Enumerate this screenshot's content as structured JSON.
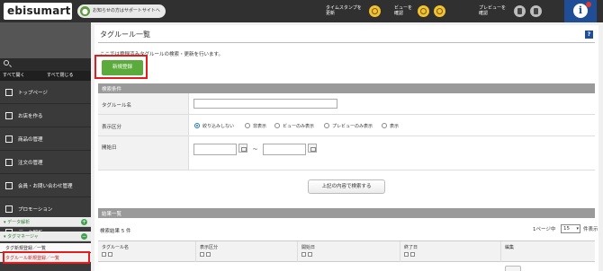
{
  "header": {
    "logo": "ebisumart",
    "support_label": "お知らせの方はサポートサイトへ",
    "timestamp_label": "タイムスタンプを\n更新",
    "view_label": "ビューを\n確認",
    "preview_label": "プレビューを\n確認",
    "info_label": "i"
  },
  "sidebar": {
    "expand_all": "すべて開く",
    "collapse_all": "すべて閉じる",
    "items": [
      {
        "label": "トップページ"
      },
      {
        "label": "お店を作る"
      },
      {
        "label": "商品の管理"
      },
      {
        "label": "注文の管理"
      },
      {
        "label": "会員・お問い合わせ管理"
      },
      {
        "label": "プロモーション"
      },
      {
        "label": "データ解析"
      }
    ],
    "groups": [
      {
        "label": "▾ データ解析",
        "toggle": "+"
      },
      {
        "label": "▾ タグマネージャ",
        "toggle": "−"
      }
    ],
    "subitems": [
      {
        "label": "タグ新規登録／一覧"
      },
      {
        "label": "タグルール新規登録／一覧"
      }
    ]
  },
  "main": {
    "title": "タグルール一覧",
    "help_icon": "?",
    "description": "ここでは登録済みタグルールの検索・更新を行います。",
    "new_button": "新規登録",
    "search_section": "検索条件",
    "fields": {
      "rule_name_label": "タグルール名",
      "rule_name_value": "",
      "display_label": "表示区分",
      "display_options": [
        "絞り込みしない",
        "非表示",
        "ビューのみ表示",
        "プレビューのみ表示",
        "表示"
      ],
      "start_date_label": "開始日",
      "range_sep": "〜"
    },
    "search_button": "上記の内容で検索する",
    "results_section": "結果一覧",
    "result_count": "検索結果 5 件",
    "per_page_label": "1ページ中",
    "per_page_value": "15",
    "per_page_suffix": "件表示",
    "columns": [
      "タグルール名",
      "表示区分",
      "開始日",
      "終了日",
      "編集"
    ]
  }
}
